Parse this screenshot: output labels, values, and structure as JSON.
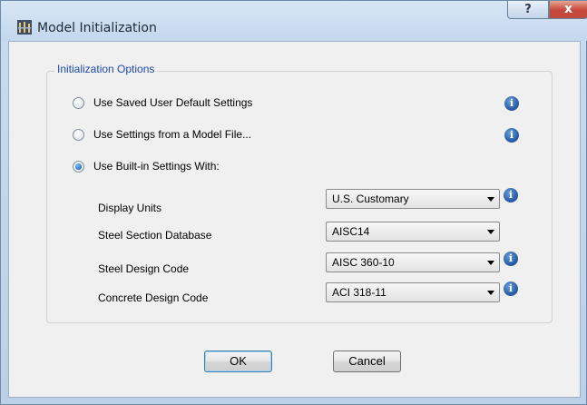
{
  "window": {
    "title": "Model Initialization",
    "help_glyph": "?",
    "close_glyph": "x"
  },
  "group": {
    "legend": "Initialization Options"
  },
  "options": [
    {
      "label": "Use Saved User Default Settings",
      "checked": false
    },
    {
      "label": "Use Settings from a Model File...",
      "checked": false
    },
    {
      "label": "Use Built-in Settings With:",
      "checked": true
    }
  ],
  "fields": [
    {
      "label": "Display Units",
      "value": "U.S. Customary"
    },
    {
      "label": "Steel Section Database",
      "value": "AISC14"
    },
    {
      "label": "Steel Design Code",
      "value": "AISC 360-10"
    },
    {
      "label": "Concrete Design Code",
      "value": "ACI 318-11"
    }
  ],
  "buttons": {
    "ok": "OK",
    "cancel": "Cancel"
  },
  "icons": {
    "info_glyph": "i"
  },
  "colors": {
    "legend_text": "#1d49a8",
    "info_icon": "#2a5fa8",
    "close_button": "#c7463a"
  }
}
